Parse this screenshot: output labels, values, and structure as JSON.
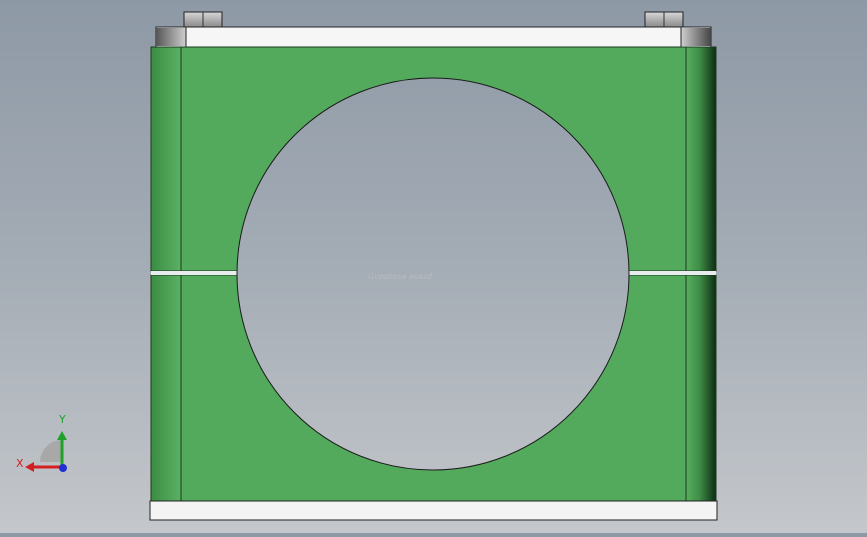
{
  "viewport": {
    "name": "graphics-area",
    "watermark_text": "Gvpgtesa asasd",
    "colors": {
      "background_top": "#8e99a6",
      "background_bottom": "#c4c7cb",
      "clamp_body": "#53aa5c",
      "clamp_edge_dark": "#2c6d33",
      "steel_plate": "#f4f4f4",
      "bolt": "#b9b9b9"
    }
  },
  "model": {
    "parts": [
      "cover-plate",
      "upper-clamp-half",
      "lower-clamp-half",
      "base-plate",
      "bolt-left",
      "bolt-right"
    ]
  },
  "triad": {
    "x_label": "X",
    "y_label": "Y",
    "x_color": "#d32020",
    "y_color": "#1fa12a",
    "z_color": "#1f2fd3"
  }
}
